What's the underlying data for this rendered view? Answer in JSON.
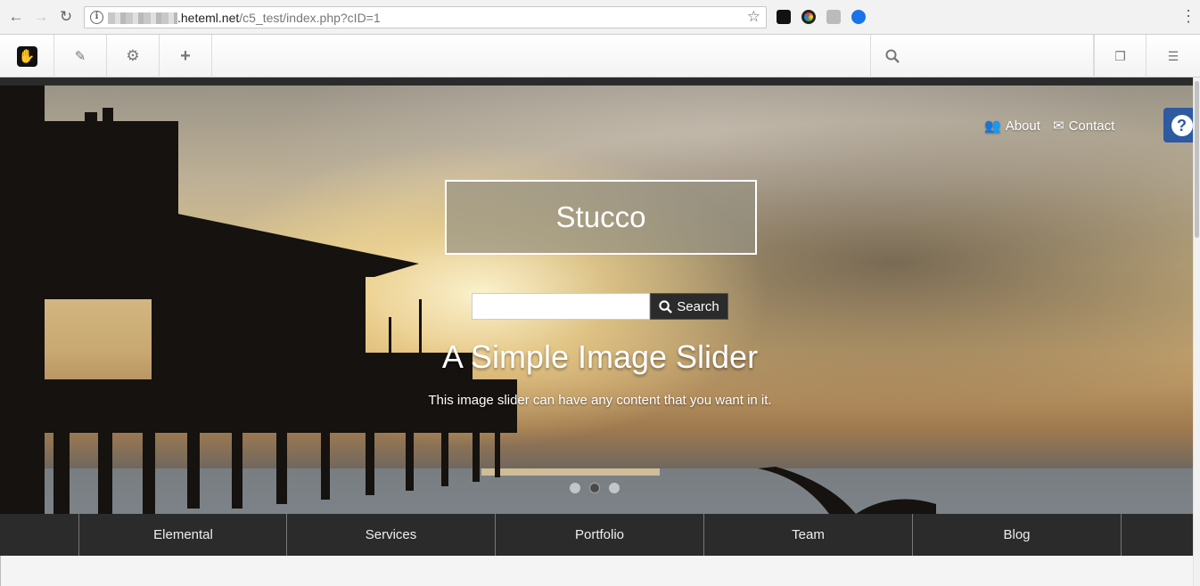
{
  "browser": {
    "url_host": ".heteml.net",
    "url_path": "/c5_test/index.php?cID=1"
  },
  "toolbar": {
    "search_placeholder": ""
  },
  "header": {
    "nav_links": [
      {
        "label": "About",
        "icon": "users-icon"
      },
      {
        "label": "Contact",
        "icon": "envelope-icon"
      }
    ],
    "site_title": "Stucco"
  },
  "search": {
    "button_label": "Search",
    "value": ""
  },
  "slider": {
    "title": "A Simple Image Slider",
    "text": "This image slider can have any content that you want in it.",
    "dot_count": 3,
    "active_dot": 2
  },
  "main_nav": {
    "items": [
      "Elemental",
      "Services",
      "Portfolio",
      "Team",
      "Blog"
    ]
  },
  "colors": {
    "nav_background": "#2b2b2b",
    "help_button": "#2d5aa0"
  }
}
